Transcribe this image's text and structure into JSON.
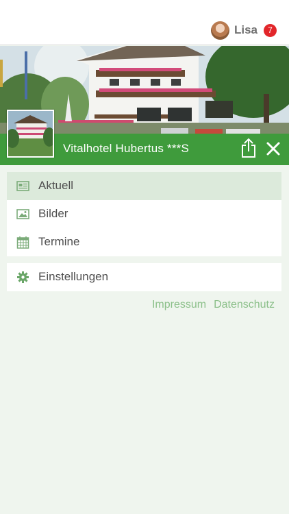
{
  "user": {
    "name": "Lisa",
    "notification_count": "7"
  },
  "hotel": {
    "title": "Vitalhotel Hubertus ***S"
  },
  "menu": {
    "items": [
      {
        "label": "Aktuell",
        "icon": "newspaper-icon",
        "active": true
      },
      {
        "label": "Bilder",
        "icon": "image-icon",
        "active": false
      },
      {
        "label": "Termine",
        "icon": "calendar-icon",
        "active": false
      }
    ],
    "settings": {
      "label": "Einstellungen",
      "icon": "gear-icon"
    }
  },
  "footer_links": {
    "impressum": "Impressum",
    "datenschutz": "Datenschutz"
  },
  "colors": {
    "brand_green": "#3f9b3c",
    "active_row": "#dceadb",
    "link_green": "#8cc08a",
    "icon_green": "#6aa668",
    "badge_red": "#e2262a",
    "background": "#eff5ee"
  }
}
